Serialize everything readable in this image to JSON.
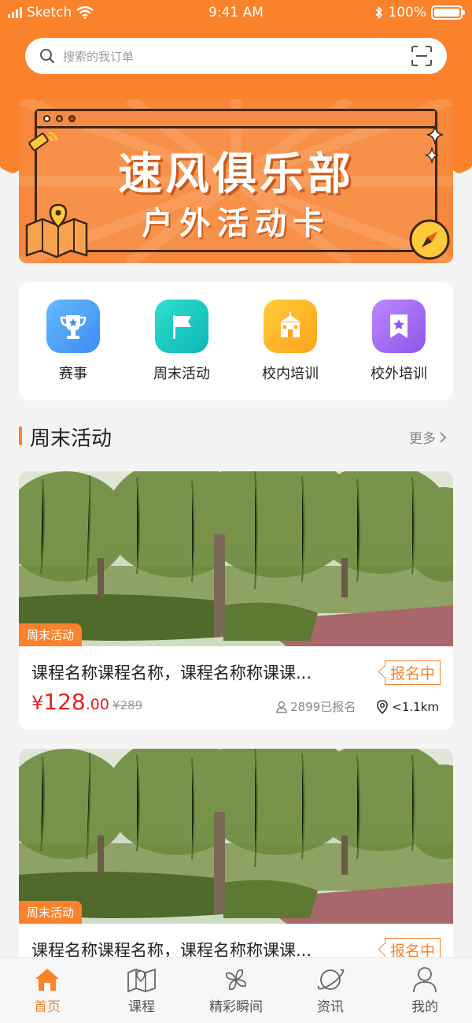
{
  "status_bar": {
    "carrier": "Sketch",
    "time": "9:41 AM",
    "battery": "100%"
  },
  "search": {
    "placeholder": "搜索的我订单"
  },
  "banner": {
    "title": "速风俱乐部",
    "subtitle": "户外活动卡"
  },
  "quick_menu": [
    {
      "label": "赛事",
      "icon": "trophy-icon",
      "color": "#4aa3f5"
    },
    {
      "label": "周末活动",
      "icon": "flag-icon",
      "color": "#1cc7c1"
    },
    {
      "label": "校内培训",
      "icon": "school-icon",
      "color": "#ffb62a"
    },
    {
      "label": "校外培训",
      "icon": "bookmark-star-icon",
      "color": "#a56cf2"
    }
  ],
  "section": {
    "title": "周末活动",
    "more": "更多"
  },
  "cards": [
    {
      "tag": "周末活动",
      "name": "课程名称课程名称，课程名称称课课...",
      "status": "报名中",
      "price_currency": "¥",
      "price_int": "128",
      "price_dec": ".00",
      "price_original": "¥289",
      "enrolled": "2899已报名",
      "distance": "<1.1km"
    },
    {
      "tag": "周末活动",
      "name": "课程名称课程名称，课程名称称课课...",
      "status": "报名中"
    }
  ],
  "tabbar": [
    {
      "label": "首页",
      "icon": "home-icon",
      "active": true
    },
    {
      "label": "课程",
      "icon": "map-icon",
      "active": false
    },
    {
      "label": "精彩瞬间",
      "icon": "pinwheel-icon",
      "active": false
    },
    {
      "label": "资讯",
      "icon": "planet-icon",
      "active": false
    },
    {
      "label": "我的",
      "icon": "user-icon",
      "active": false
    }
  ],
  "colors": {
    "accent": "#f9822b",
    "price": "#e81f1f"
  }
}
